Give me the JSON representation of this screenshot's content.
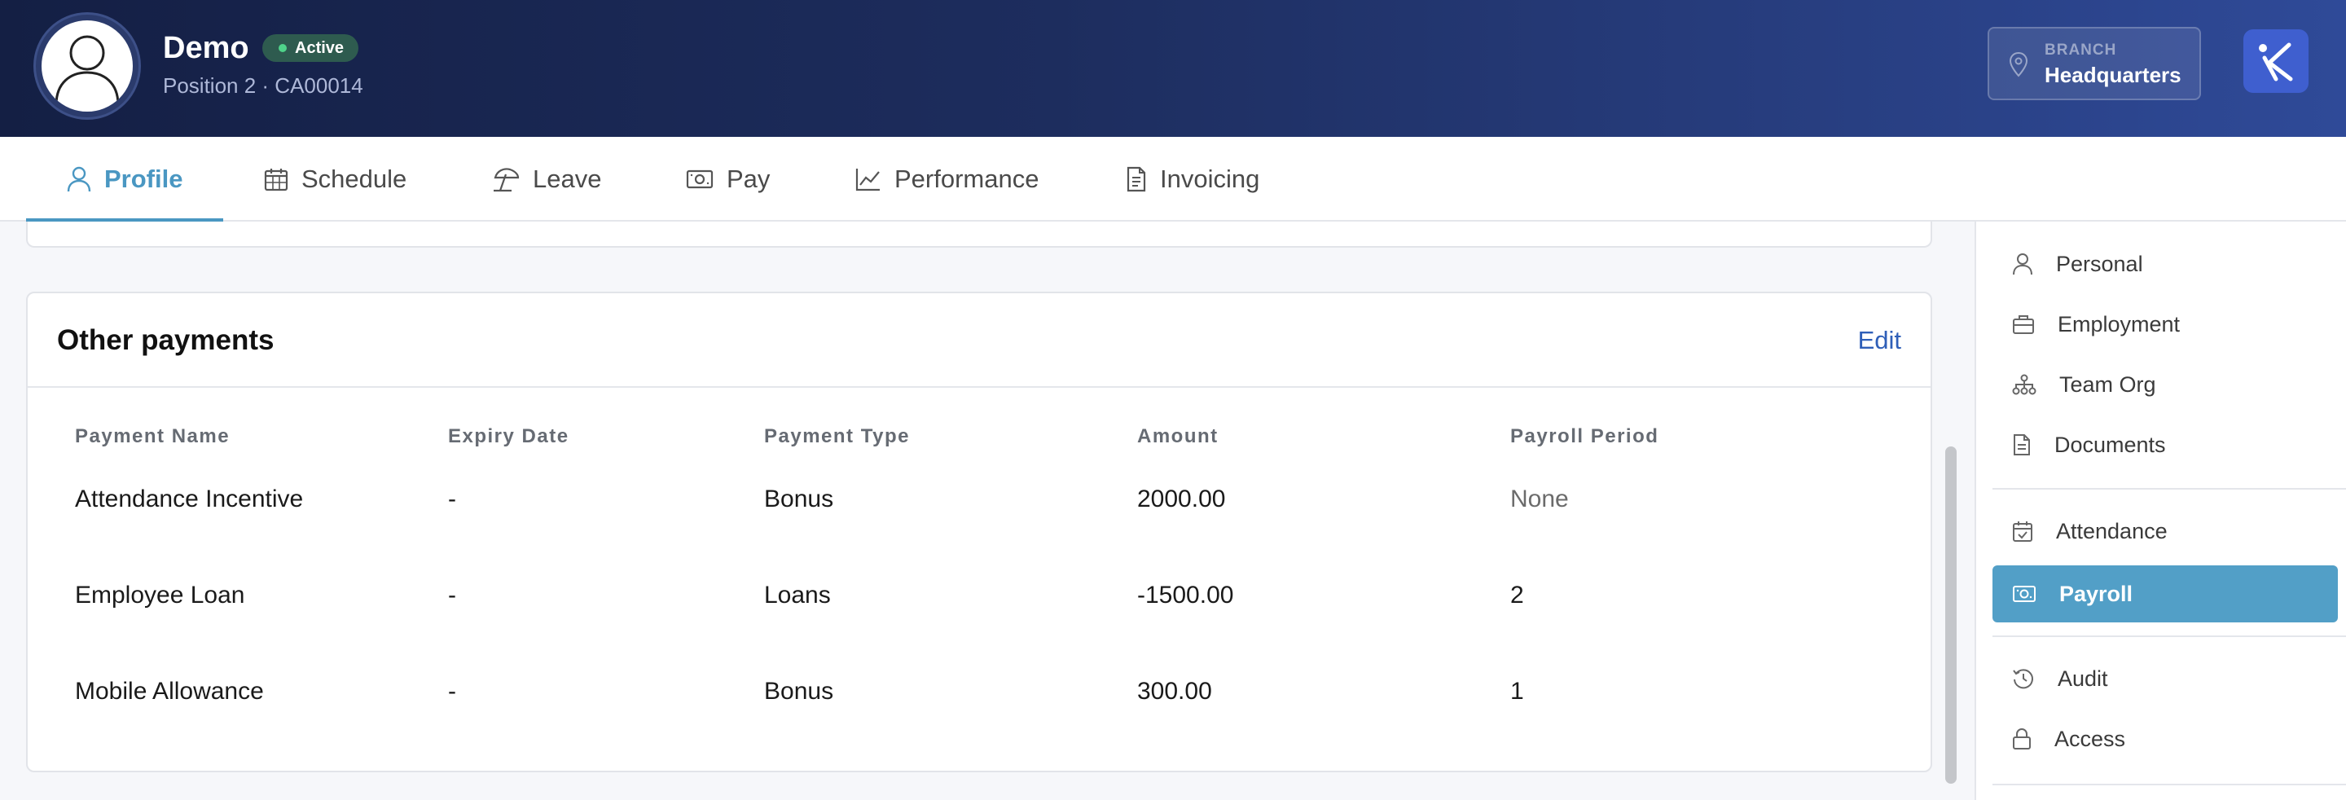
{
  "header": {
    "name": "Demo",
    "status": "Active",
    "subtitle": "Position 2 · CA00014",
    "branch_label": "BRANCH",
    "branch_value": "Headquarters"
  },
  "tabs": [
    {
      "label": "Profile",
      "icon": "person-icon",
      "active": true
    },
    {
      "label": "Schedule",
      "icon": "calendar-icon"
    },
    {
      "label": "Leave",
      "icon": "beach-umbrella-icon"
    },
    {
      "label": "Pay",
      "icon": "banknote-icon"
    },
    {
      "label": "Performance",
      "icon": "line-chart-icon"
    },
    {
      "label": "Invoicing",
      "icon": "invoice-icon"
    }
  ],
  "card": {
    "title": "Other payments",
    "edit_label": "Edit",
    "columns": [
      "Payment Name",
      "Expiry Date",
      "Payment Type",
      "Amount",
      "Payroll Period"
    ],
    "rows": [
      [
        "Attendance Incentive",
        "-",
        "Bonus",
        "2000.00",
        "None"
      ],
      [
        "Employee Loan",
        "-",
        "Loans",
        "-1500.00",
        "2"
      ],
      [
        "Mobile Allowance",
        "-",
        "Bonus",
        "300.00",
        "1"
      ]
    ]
  },
  "sidebar": {
    "items": [
      {
        "label": "Personal",
        "icon": "person-icon"
      },
      {
        "label": "Employment",
        "icon": "briefcase-icon"
      },
      {
        "label": "Team Org",
        "icon": "org-chart-icon"
      },
      {
        "label": "Documents",
        "icon": "document-icon"
      },
      {
        "label": "Attendance",
        "icon": "calendar-check-icon"
      },
      {
        "label": "Payroll",
        "icon": "banknote-icon",
        "active": true
      },
      {
        "label": "Audit",
        "icon": "history-icon"
      },
      {
        "label": "Access",
        "icon": "lock-icon"
      }
    ]
  },
  "colors": {
    "header_start": "#141f44",
    "header_end": "#2f4a98",
    "accent": "#4a97c2",
    "sidebar_active": "#529fc7",
    "status_badge": "#2e5b4f",
    "link": "#2f5fb8"
  }
}
